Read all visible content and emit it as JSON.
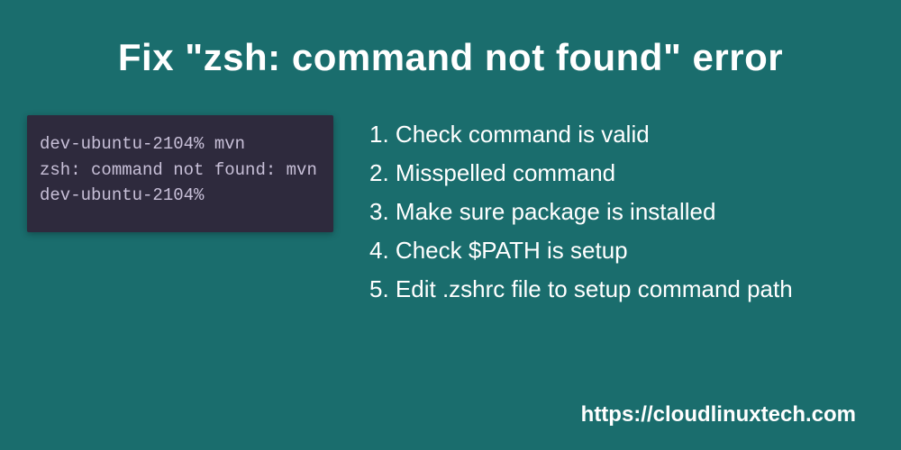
{
  "title": "Fix \"zsh: command not found\" error",
  "terminal": {
    "lines": [
      "dev-ubuntu-2104% mvn",
      "zsh: command not found: mvn",
      "dev-ubuntu-2104%"
    ]
  },
  "steps": [
    "Check command is valid",
    "Misspelled command",
    "Make sure package is installed",
    "Check $PATH is setup",
    "Edit .zshrc file to setup command path"
  ],
  "footer": "https://cloudlinuxtech.com"
}
